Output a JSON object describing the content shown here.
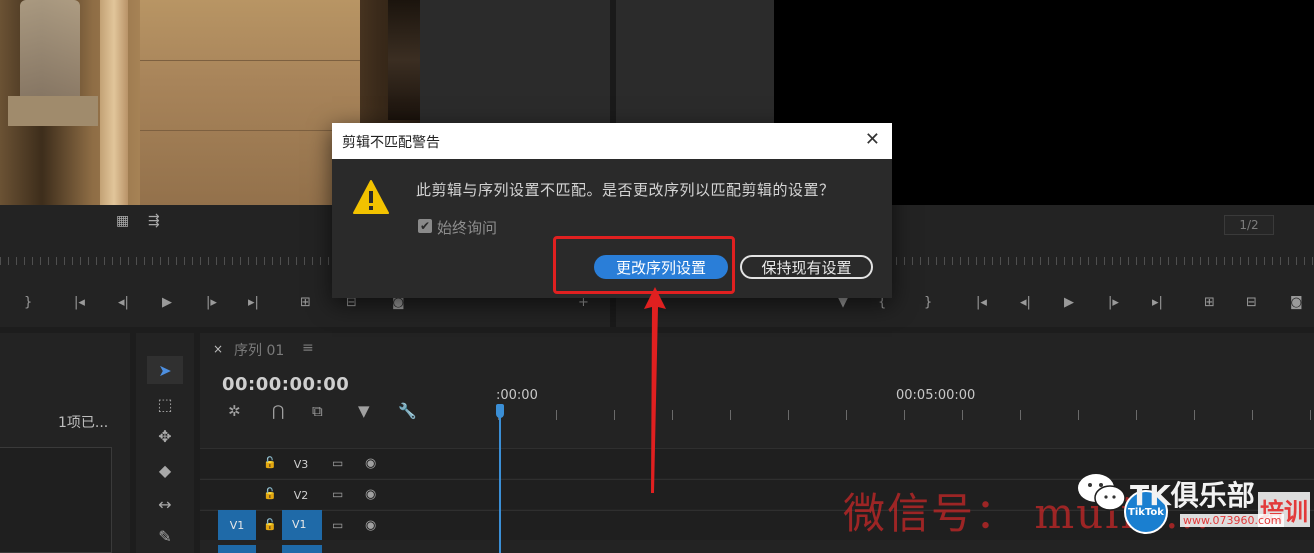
{
  "dialog": {
    "title": "剪辑不匹配警告",
    "message": "此剪辑与序列设置不匹配。是否更改序列以匹配剪辑的设置？",
    "checkbox_label": "始终询问",
    "checkbox_checked": true,
    "primary_button": "更改序列设置",
    "secondary_button": "保持现有设置",
    "close_symbol": "✕"
  },
  "source_monitor": {
    "icons": [
      "film-icon",
      "waves-icon"
    ]
  },
  "program_monitor": {
    "page_indicator": "1/2"
  },
  "project_panel": {
    "item_count": "1项已..."
  },
  "timeline": {
    "tab_close": "×",
    "tab_title": "序列 01",
    "tab_menu": "≡",
    "timecode": "00:00:00:00",
    "time_labels": [
      ":00:00",
      "00:05:00:00"
    ],
    "tracks": [
      {
        "label": "V3"
      },
      {
        "label": "V2"
      },
      {
        "label": "V1"
      }
    ],
    "v1_source_label": "V1"
  },
  "watermark": {
    "wechat_text": "微信号： muliu...",
    "brand": "TK俱乐部",
    "badge": "培训",
    "url": "www.073960.com",
    "tiktok": "TikTok"
  },
  "colors": {
    "accent_blue": "#2a7ed8",
    "annotation_red": "#e02020",
    "warning_yellow": "#f2c200"
  }
}
